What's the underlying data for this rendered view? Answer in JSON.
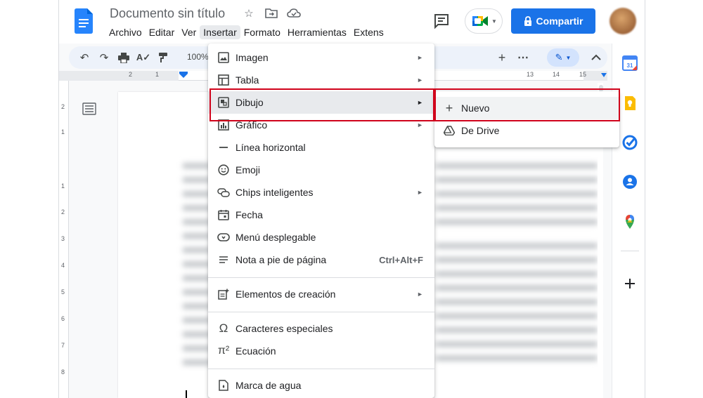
{
  "document": {
    "title": "Documento sin título",
    "zoom": "100%"
  },
  "menubar": [
    {
      "label": "Archivo",
      "active": false
    },
    {
      "label": "Editar",
      "active": false
    },
    {
      "label": "Ver",
      "active": false
    },
    {
      "label": "Insertar",
      "active": true
    },
    {
      "label": "Formato",
      "active": false
    },
    {
      "label": "Herramientas",
      "active": false
    },
    {
      "label": "Extens",
      "active": false
    }
  ],
  "share": {
    "label": "Compartir"
  },
  "ruler": {
    "h_ticks": [
      "2",
      "1",
      "1",
      "2",
      "13",
      "14",
      "15"
    ],
    "v_ticks": [
      "2",
      "1",
      "1",
      "2",
      "3",
      "4",
      "5",
      "6",
      "7",
      "8"
    ]
  },
  "insert_menu": {
    "items": [
      {
        "label": "Imagen",
        "icon": "image-icon",
        "submenu": true
      },
      {
        "label": "Tabla",
        "icon": "table-icon",
        "submenu": true
      },
      {
        "label": "Dibujo",
        "icon": "drawing-icon",
        "submenu": true,
        "highlighted": true
      },
      {
        "label": "Gráfico",
        "icon": "chart-icon",
        "submenu": true
      },
      {
        "label": "Línea horizontal",
        "icon": "horizontal-line-icon",
        "submenu": false
      },
      {
        "label": "Emoji",
        "icon": "emoji-icon",
        "submenu": false
      },
      {
        "label": "Chips inteligentes",
        "icon": "smart-chips-icon",
        "submenu": true
      },
      {
        "label": "Fecha",
        "icon": "calendar-icon",
        "submenu": false
      },
      {
        "label": "Menú desplegable",
        "icon": "dropdown-icon",
        "submenu": false
      },
      {
        "label": "Nota a pie de página",
        "icon": "footnote-icon",
        "submenu": false,
        "shortcut": "Ctrl+Alt+F"
      },
      {
        "label": "Elementos de creación",
        "icon": "building-blocks-icon",
        "submenu": true
      },
      {
        "label": "Caracteres especiales",
        "icon": "omega-icon",
        "submenu": false
      },
      {
        "label": "Ecuación",
        "icon": "pi-icon",
        "submenu": false
      },
      {
        "label": "Marca de agua",
        "icon": "watermark-icon",
        "submenu": false
      }
    ]
  },
  "drawing_submenu": {
    "items": [
      {
        "label": "Nuevo",
        "icon": "plus-icon"
      },
      {
        "label": "De Drive",
        "icon": "drive-icon"
      }
    ]
  },
  "colors": {
    "accent": "#1a73e8",
    "highlight_box": "#d0021b",
    "menu_hover": "#e8eaed"
  }
}
